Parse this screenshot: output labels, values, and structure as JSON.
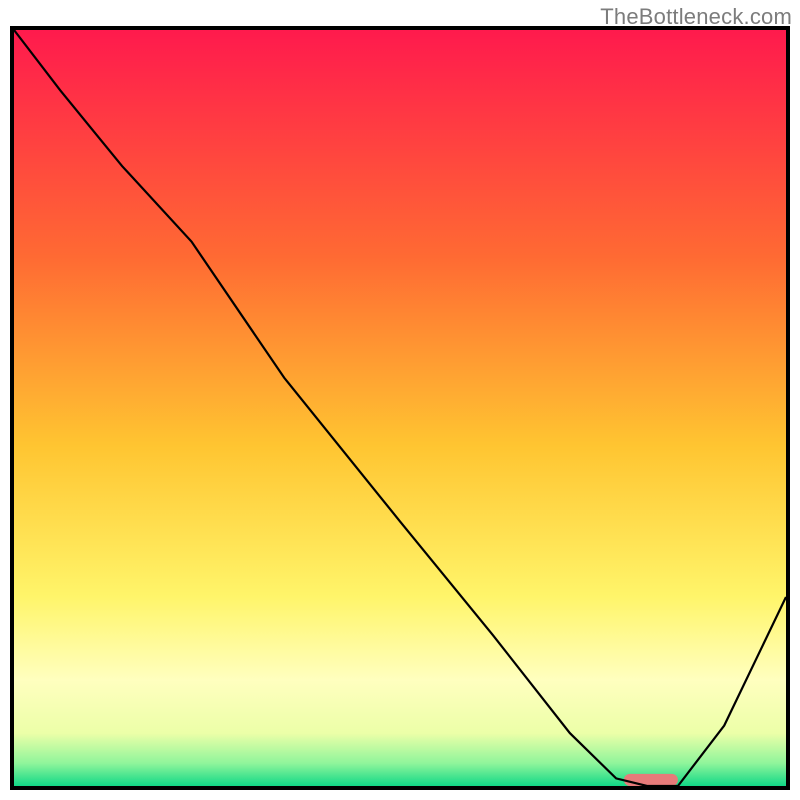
{
  "watermark": "TheBottleneck.com",
  "chart_data": {
    "type": "line",
    "title": "",
    "xlabel": "",
    "ylabel": "",
    "xlim": [
      0,
      100
    ],
    "ylim": [
      0,
      100
    ],
    "grid": false,
    "legend": false,
    "background_gradient": {
      "stops": [
        {
          "offset": 0,
          "color": "#ff1a4d"
        },
        {
          "offset": 30,
          "color": "#ff6a33"
        },
        {
          "offset": 55,
          "color": "#ffc531"
        },
        {
          "offset": 75,
          "color": "#fff56a"
        },
        {
          "offset": 86,
          "color": "#ffffbf"
        },
        {
          "offset": 93,
          "color": "#ecffa8"
        },
        {
          "offset": 97,
          "color": "#8ff59b"
        },
        {
          "offset": 100,
          "color": "#11d887"
        }
      ]
    },
    "series": [
      {
        "name": "bottleneck-curve",
        "type": "line",
        "color": "#000000",
        "width": 2.2,
        "x": [
          0,
          6,
          14,
          23,
          35,
          50,
          62,
          72,
          78,
          82,
          86,
          92,
          100
        ],
        "y": [
          100,
          92,
          82,
          72,
          54,
          35,
          20,
          7,
          1,
          0,
          0,
          8,
          25
        ]
      }
    ],
    "marker": {
      "name": "optimal-zone-marker",
      "color": "#e77b7a",
      "x_start": 79,
      "x_end": 86,
      "y": 0,
      "height": 1.6
    }
  }
}
